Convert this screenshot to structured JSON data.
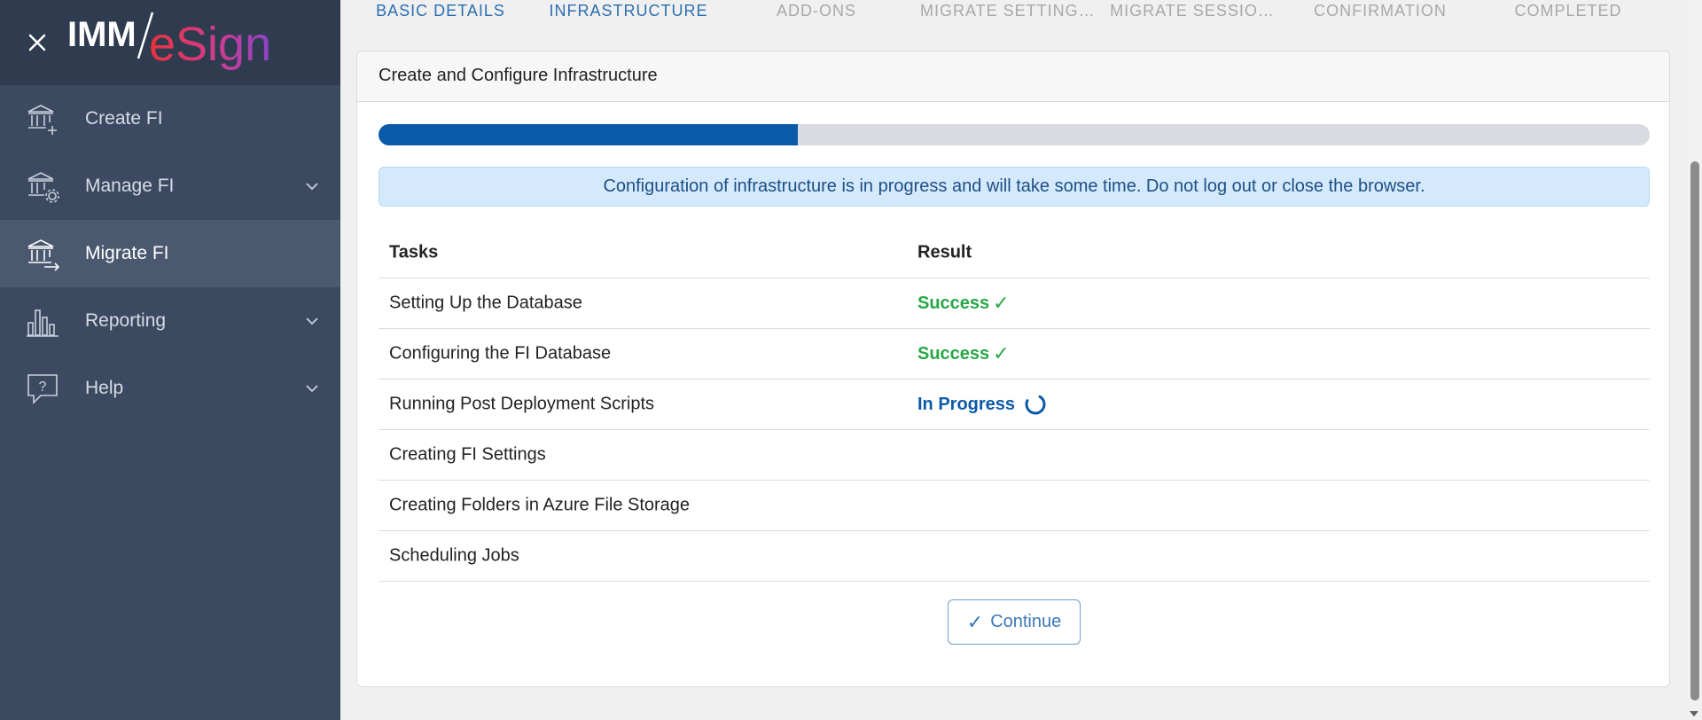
{
  "app": {
    "logo_text": "IMM eSign",
    "accent_color": "#0b5aa8",
    "success_color": "#28a745"
  },
  "sidebar": {
    "items": [
      {
        "label": "Create FI",
        "icon": "bank-plus-icon",
        "has_chevron": false,
        "active": false
      },
      {
        "label": "Manage FI",
        "icon": "bank-gear-icon",
        "has_chevron": true,
        "active": false
      },
      {
        "label": "Migrate FI",
        "icon": "bank-arrow-icon",
        "has_chevron": false,
        "active": true
      },
      {
        "label": "Reporting",
        "icon": "bar-chart-icon",
        "has_chevron": true,
        "active": false
      },
      {
        "label": "Help",
        "icon": "help-chat-icon",
        "has_chevron": true,
        "active": false
      }
    ]
  },
  "stepper": {
    "steps": [
      {
        "label": "BASIC DETAILS",
        "state": "done"
      },
      {
        "label": "INFRASTRUCTURE",
        "state": "current"
      },
      {
        "label": "ADD-ONS",
        "state": "pending"
      },
      {
        "label": "MIGRATE SETTING…",
        "state": "pending"
      },
      {
        "label": "MIGRATE SESSIO…",
        "state": "pending"
      },
      {
        "label": "CONFIRMATION",
        "state": "pending"
      },
      {
        "label": "COMPLETED",
        "state": "pending"
      }
    ]
  },
  "panel": {
    "title": "Create and Configure Infrastructure",
    "progress_fraction": 0.33,
    "alert": "Configuration of infrastructure is in progress and will take some time. Do not log out or close the browser.",
    "table": {
      "headers": {
        "task": "Tasks",
        "result": "Result"
      },
      "rows": [
        {
          "task": "Setting Up the Database",
          "result": "Success",
          "status": "success"
        },
        {
          "task": "Configuring the FI Database",
          "result": "Success",
          "status": "success"
        },
        {
          "task": "Running Post Deployment Scripts",
          "result": "In Progress",
          "status": "progress"
        },
        {
          "task": "Creating FI Settings",
          "result": "",
          "status": "none"
        },
        {
          "task": "Creating Folders in Azure File Storage",
          "result": "",
          "status": "none"
        },
        {
          "task": "Scheduling Jobs",
          "result": "",
          "status": "none"
        }
      ]
    },
    "continue_label": "Continue"
  }
}
